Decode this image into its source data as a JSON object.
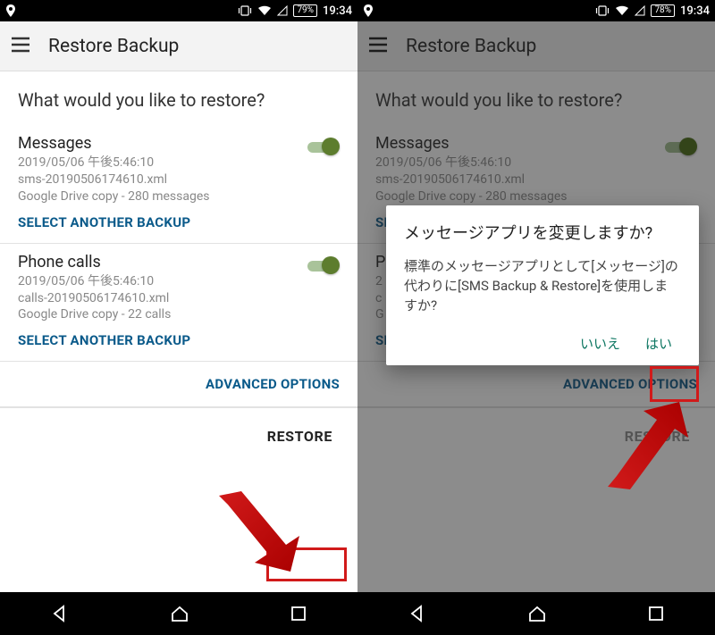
{
  "left": {
    "status": {
      "battery": "79%",
      "time": "19:34"
    },
    "appbar": {
      "title": "Restore Backup"
    },
    "heading": "What would you like to restore?",
    "messages": {
      "title": "Messages",
      "line1": "2019/05/06 午後5:46:10",
      "line2": "sms-20190506174610.xml",
      "line3": "Google Drive copy - 280 messages",
      "link": "SELECT ANOTHER BACKUP"
    },
    "calls": {
      "title": "Phone calls",
      "line1": "2019/05/06 午後5:46:10",
      "line2": "calls-20190506174610.xml",
      "line3": "Google Drive copy - 22 calls",
      "link": "SELECT ANOTHER BACKUP"
    },
    "advanced": "ADVANCED OPTIONS",
    "restore": "RESTORE"
  },
  "right": {
    "status": {
      "battery": "78%",
      "time": "19:34"
    },
    "appbar": {
      "title": "Restore Backup"
    },
    "heading": "What would you like to restore?",
    "messages": {
      "title": "Messages",
      "line1": "2019/05/06 午後5:46:10",
      "line2": "sms-20190506174610.xml",
      "line3": "Google Drive copy - 280 messages",
      "link": "SELECT ANOTHER BACKUP"
    },
    "calls": {
      "title": "P",
      "line1": "2",
      "line2": "c",
      "line3": "G",
      "link": "SELECT ANOTHER BACKUP"
    },
    "advanced": "ADVANCED OPTIONS",
    "restore": "RESTORE",
    "dialog": {
      "title": "メッセージアプリを変更しますか?",
      "body": "標準のメッセージアプリとして[メッセージ]の代わりに[SMS Backup & Restore]を使用しますか?",
      "no": "いいえ",
      "yes": "はい"
    }
  }
}
